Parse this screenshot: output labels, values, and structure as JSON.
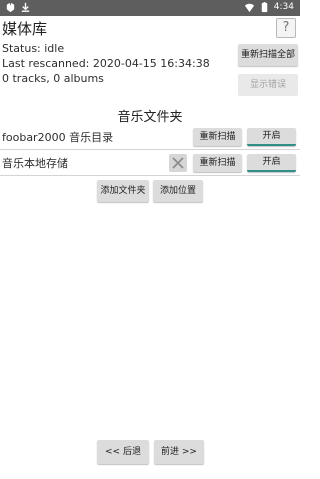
{
  "status_bar": {
    "time": "4:34",
    "left_icons": [
      "app-icon",
      "download-icon"
    ],
    "right_icons": [
      "wifi-icon",
      "battery-icon"
    ]
  },
  "header": {
    "title": "媒体库",
    "help_label": "?"
  },
  "status": {
    "status_line": "Status: idle",
    "last_rescanned": "Last rescanned: 2020-04-15 16:34:38",
    "counts": "0 tracks, 0 albums"
  },
  "actions": {
    "rescan_all": "重新扫描全部",
    "show_errors": "显示错误"
  },
  "folders": {
    "section_title": "音乐文件夹",
    "items": [
      {
        "label": "foobar2000 音乐目录",
        "rescan": "重新扫描",
        "toggle": "开启"
      },
      {
        "label": "音乐本地存储",
        "rescan": "重新扫描",
        "toggle": "开启"
      }
    ],
    "add_folder": "添加文件夹",
    "add_location": "添加位置"
  },
  "navigation": {
    "back": "<< 后退",
    "forward": "前进 >>"
  },
  "colors": {
    "status_bar": "#5e5e5e",
    "accent": "#2f8f86",
    "button": "#dcdcdc"
  }
}
